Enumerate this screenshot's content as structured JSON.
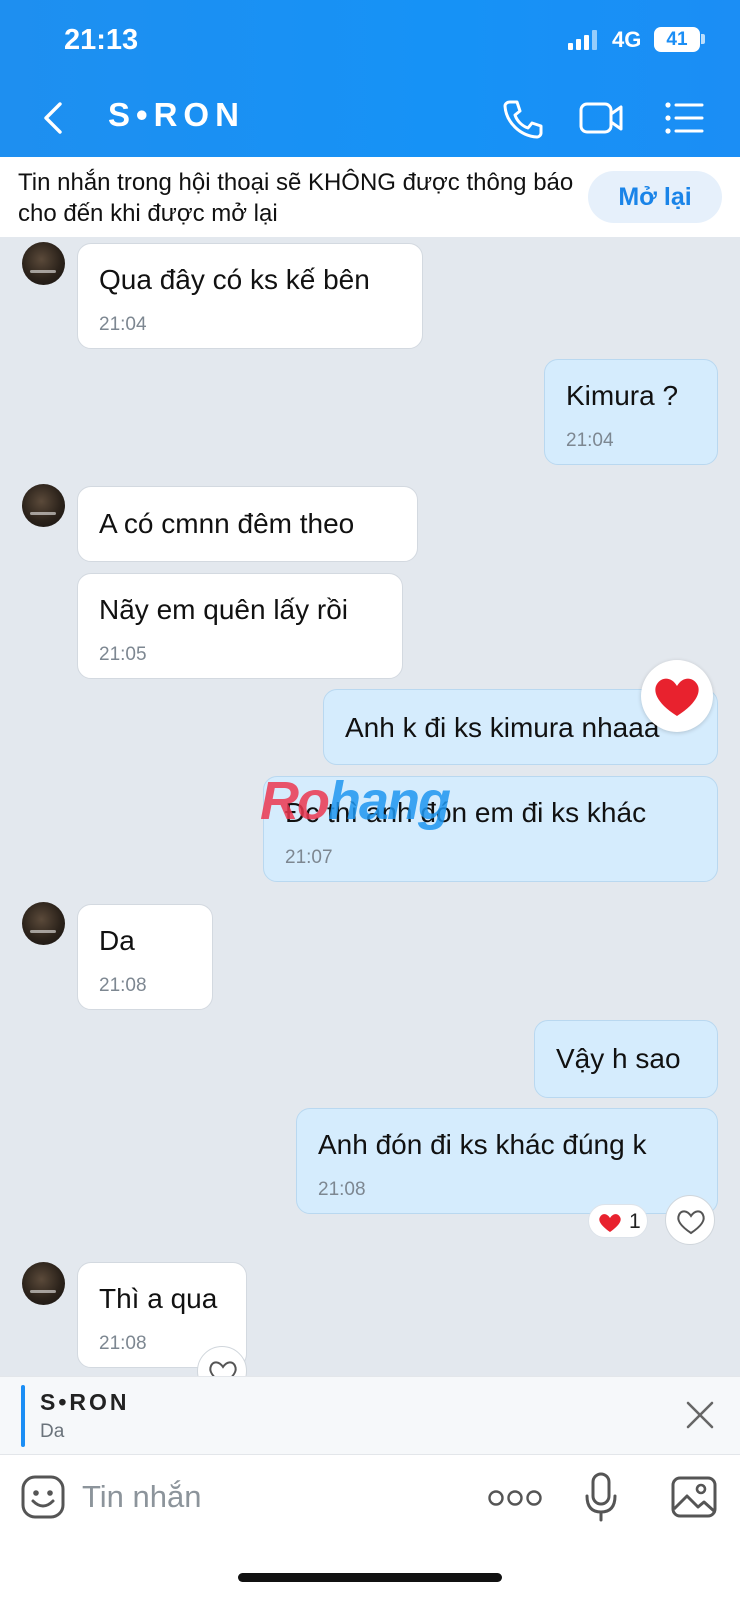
{
  "status_bar": {
    "time": "21:13",
    "network": "4G",
    "battery": "41"
  },
  "header": {
    "title": "S•RON"
  },
  "banner": {
    "text": "Tin nhắn trong hội thoại sẽ KHÔNG được thông báo cho đến khi được mở lại",
    "button": "Mở lại"
  },
  "messages": [
    {
      "side": "in",
      "text": "Qua đây có ks kế bên",
      "time": "21:04"
    },
    {
      "side": "out",
      "text": "Kimura ?",
      "time": "21:04"
    },
    {
      "side": "in",
      "text": "A có cmnn đêm theo",
      "time": ""
    },
    {
      "side": "in",
      "text": "Nãy em quên lấy rồi",
      "time": "21:05"
    },
    {
      "side": "out",
      "text": "Anh k đi ks kimura nhaaa",
      "time": ""
    },
    {
      "side": "out",
      "text": "Đc thì anh đón em đi ks khác",
      "time": "21:07"
    },
    {
      "side": "in",
      "text": "Da",
      "time": "21:08"
    },
    {
      "side": "out",
      "text": "Vậy h sao",
      "time": ""
    },
    {
      "side": "out",
      "text": "Anh đón đi ks khác đúng k",
      "time": "21:08"
    },
    {
      "side": "in",
      "text": "Thì a qua",
      "time": "21:08"
    }
  ],
  "reactions": {
    "heart_count": "1"
  },
  "watermark": {
    "part1": "Ro",
    "part2": "hang"
  },
  "reply": {
    "name": "S•RON",
    "message": "Da"
  },
  "input": {
    "placeholder": "Tin nhắn"
  },
  "colors": {
    "header": "#1b8ef5",
    "outgoing_bubble": "#d5ecfd",
    "incoming_bubble": "#ffffff",
    "background": "#e3e8ee"
  }
}
